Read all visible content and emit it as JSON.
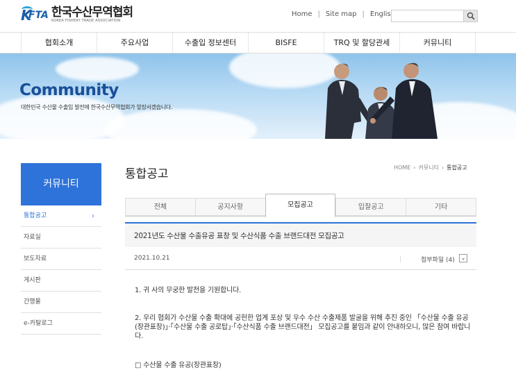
{
  "header": {
    "logo_kr": "한국수산무역협회",
    "logo_en": "KOREA FISHERY TRADE ASSOCIATION",
    "util_links": [
      "Home",
      "Site map",
      "English"
    ],
    "search_placeholder": ""
  },
  "gnb": [
    "협회소개",
    "주요사업",
    "수출입 정보센터",
    "BISFE",
    "TRQ 및 할당관세",
    "커뮤니티"
  ],
  "banner": {
    "title": "Community",
    "subtitle": "대한민국 수산물 수출입 발전에 한국수산무역협회가 앞장서겠습니다."
  },
  "sidebar": {
    "heading": "커뮤니티",
    "items": [
      {
        "label": "통합공고",
        "active": true
      },
      {
        "label": "자료실"
      },
      {
        "label": "보도자료"
      },
      {
        "label": "게시판"
      },
      {
        "label": "간행물"
      },
      {
        "label": "e-카탈로그"
      }
    ]
  },
  "page": {
    "title": "통합공고",
    "breadcrumb": [
      "HOME",
      "커뮤니티",
      "통합공고"
    ]
  },
  "tabs": [
    {
      "label": "전체"
    },
    {
      "label": "공지사항"
    },
    {
      "label": "모집공고",
      "active": true
    },
    {
      "label": "입찰공고"
    },
    {
      "label": "기타"
    }
  ],
  "post": {
    "title": "2021년도 수산물 수출유공 표창 및 수산식품 수출 브랜드대전 모집공고",
    "date": "2021.10.21",
    "attachments": "첨부파일 (4)",
    "p1": "1. 귀 사의 무궁한 발전을 기원합니다.",
    "p2": "2. 우리 협회가 수산물 수출 확대에 공헌한 업계 포상 및 우수 수산 수출제품 발굴을 위해 추진 중인 「수산물 수출 유공(장관표창)」·「수산물 수출 공로탑」·「수산식품 수출 브랜드대전」 모집공고를 붙임과 같이 안내하오니, 많은 참여 바랍니다.",
    "p3": "□ 수산물 수출 유공(장관표창)"
  },
  "colors": {
    "accent": "#2e73d9",
    "brand": "#1a5ea8"
  }
}
